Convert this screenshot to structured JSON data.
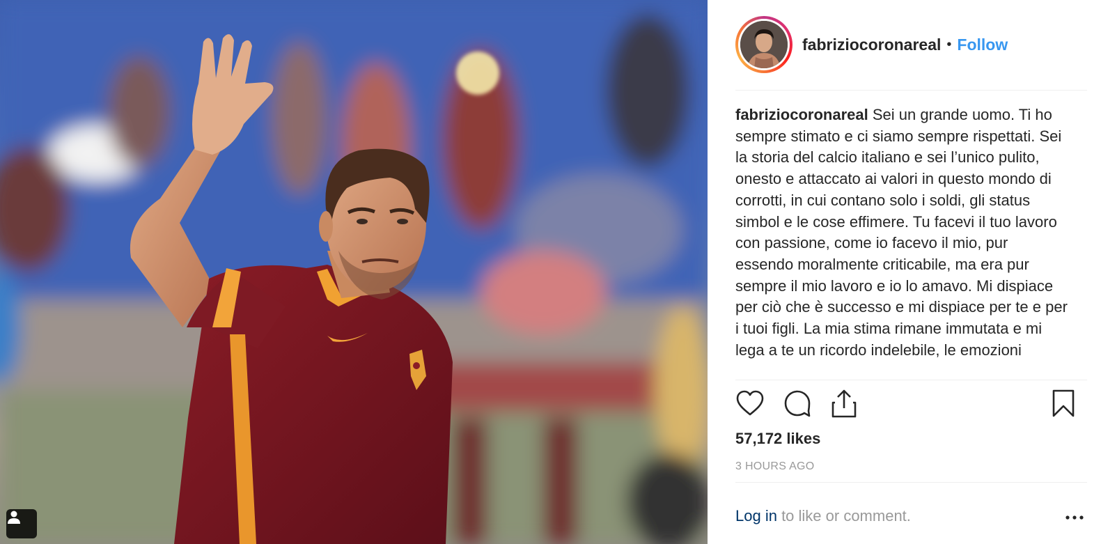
{
  "post": {
    "username": "fabriziocoronareal",
    "separator": "•",
    "follow_label": "Follow",
    "caption_user": "fabriziocoronareal",
    "caption_text": "Sei un grande uomo. Ti ho sempre stimato e ci siamo sempre rispettati. Sei la storia del calcio italiano e sei l’unico pulito, onesto e attaccato ai valori in questo mondo di corrotti, in cui contano solo i soldi, gli status simbol e le cose effimere. Tu facevi il tuo lavoro con passione, come io facevo il mio, pur essendo moralmente criticabile, ma era pur sempre il mio lavoro e io lo amavo. Mi dispiace per ciò che è successo e mi dispiace per te e per i tuoi figli. La mia stima rimane immutata e mi lega a te un ricordo indelebile, le emozioni",
    "likes": "57,172 likes",
    "timestamp": "3 HOURS AGO",
    "login_link": "Log in",
    "login_rest": " to like or comment."
  },
  "icons": {
    "like": "heart-icon",
    "comment": "comment-icon",
    "share": "share-icon",
    "save": "bookmark-icon",
    "more": "more-dots-icon",
    "tag": "user-tag-icon"
  },
  "colors": {
    "follow": "#3897f0",
    "login": "#003569",
    "muted": "#999999",
    "text": "#262626"
  }
}
